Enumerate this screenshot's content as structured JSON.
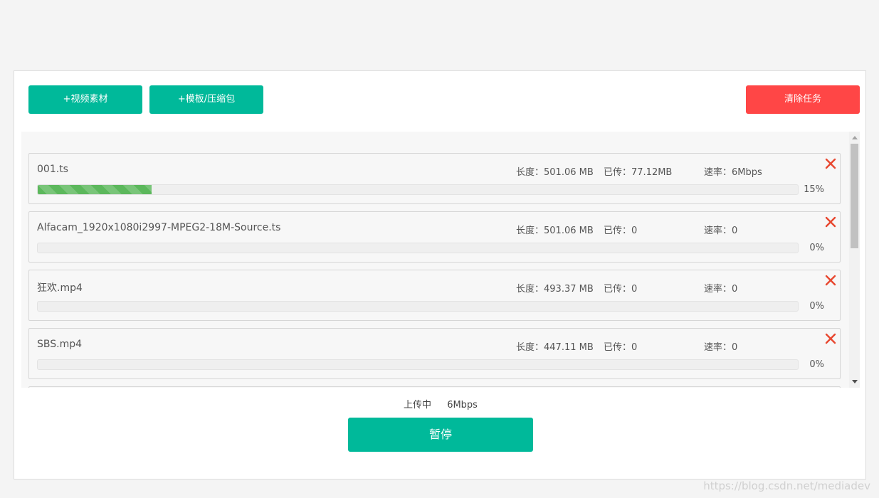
{
  "toolbar": {
    "add_video_label": "+视频素材",
    "add_template_label": "+模板/压缩包",
    "clear_tasks_label": "清除任务"
  },
  "tasks": [
    {
      "name": "001.ts",
      "size": "长度：501.06 MB",
      "uploaded": "已传：77.12MB",
      "rate": "速率：6Mbps",
      "progress_label": "15%",
      "progress": 15
    },
    {
      "name": "Alfacam_1920x1080i2997-MPEG2-18M-Source.ts",
      "size": "长度：501.06 MB",
      "uploaded": "已传：0",
      "rate": "速率：0",
      "progress_label": "0%",
      "progress": 0
    },
    {
      "name": "狂欢.mp4",
      "size": "长度：493.37 MB",
      "uploaded": "已传：0",
      "rate": "速率：0",
      "progress_label": "0%",
      "progress": 0
    },
    {
      "name": "SBS.mp4",
      "size": "长度：447.11 MB",
      "uploaded": "已传：0",
      "rate": "速率：0",
      "progress_label": "0%",
      "progress": 0
    }
  ],
  "status": {
    "state": "上传中",
    "speed": "6Mbps"
  },
  "pause_label": "暂停",
  "watermark": "https://blog.csdn.net/mediadev",
  "colors": {
    "primary": "#00b99a",
    "danger": "#ff4646",
    "progress": "#5cb85c",
    "close_icon": "#e8472f"
  },
  "icons": {
    "close": "close-icon",
    "scroll_up": "arrow-up-icon",
    "scroll_down": "arrow-down-icon"
  }
}
